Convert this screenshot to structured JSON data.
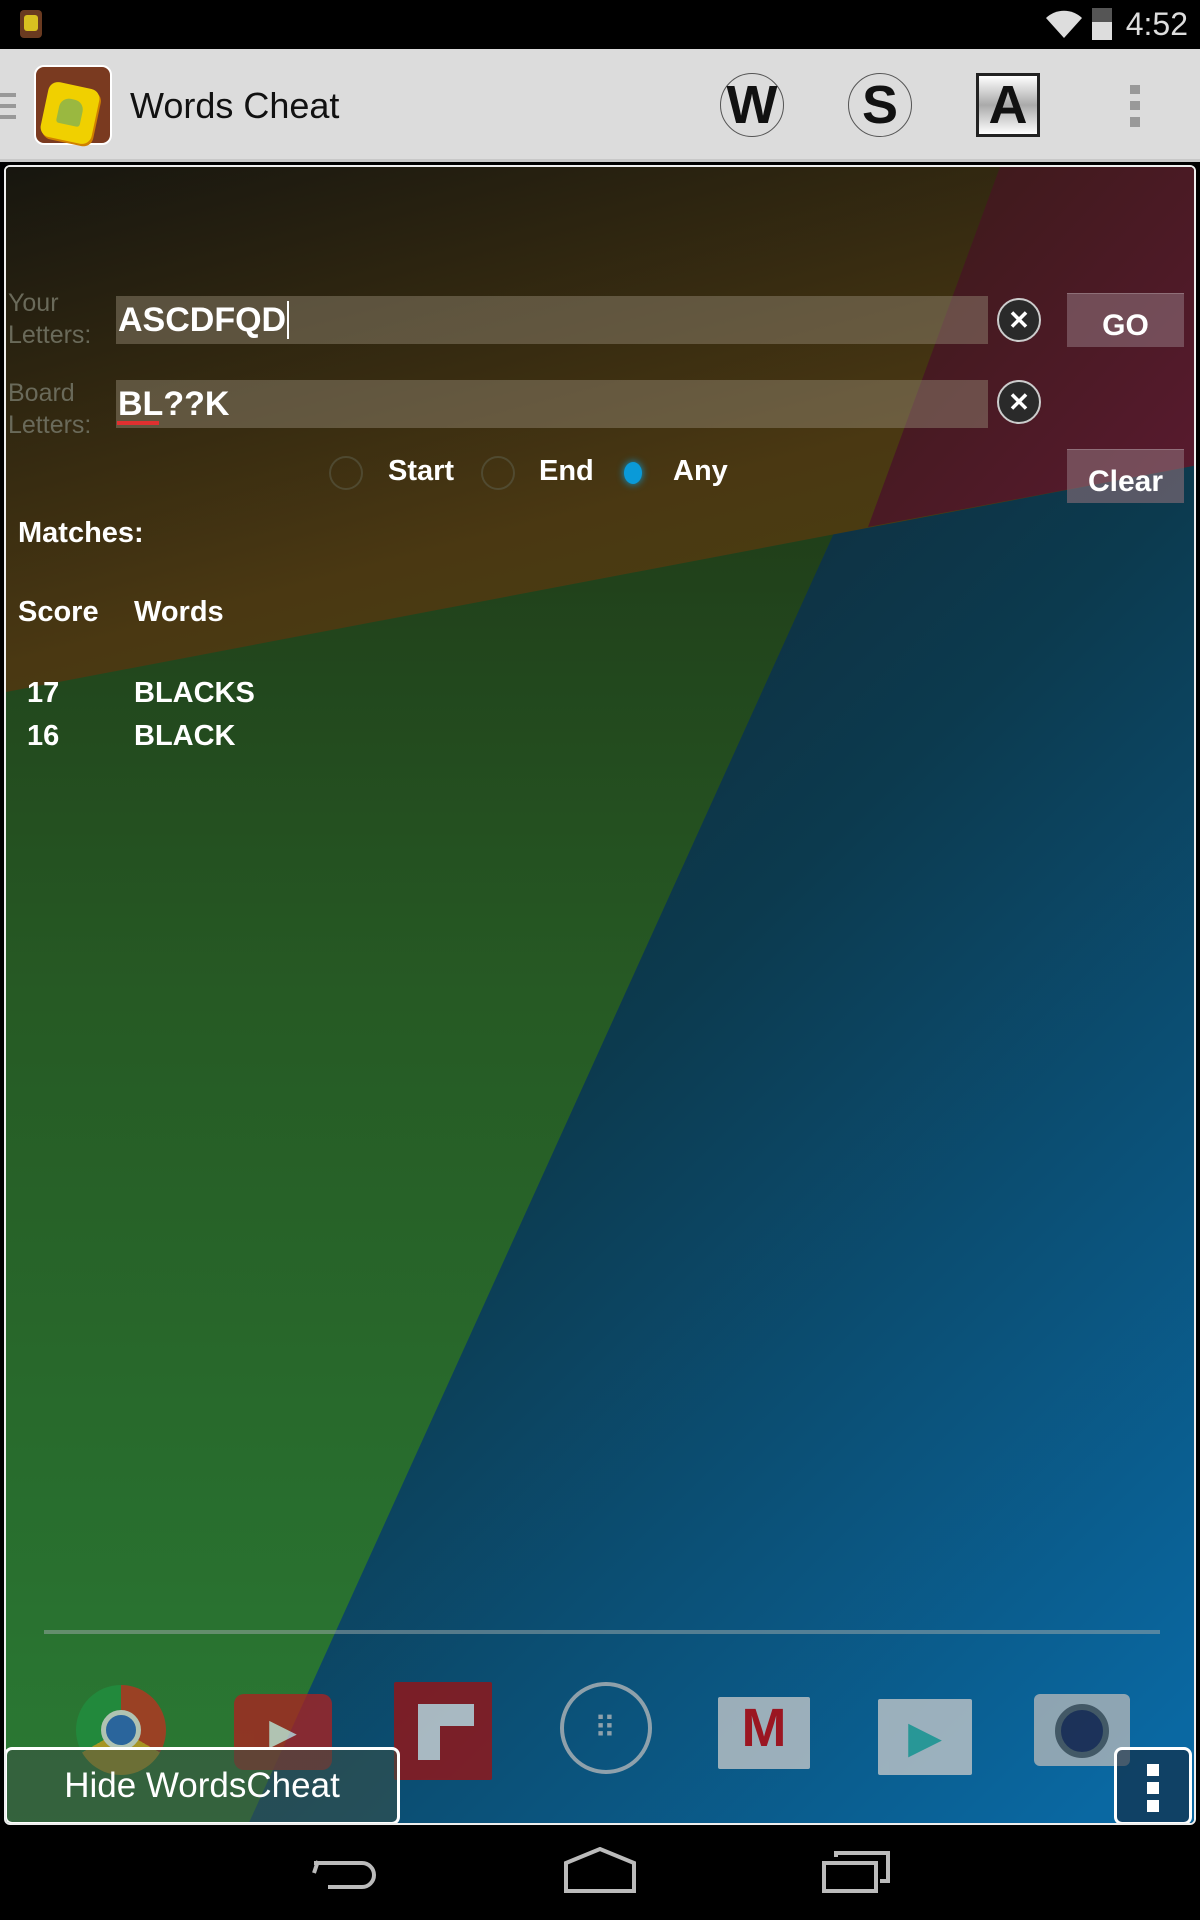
{
  "status_bar": {
    "time": "4:52"
  },
  "action_bar": {
    "title": "Words Cheat",
    "mode_buttons": [
      "W",
      "S",
      "A"
    ]
  },
  "form": {
    "your_letters_label": [
      "Your",
      "Letters:"
    ],
    "your_letters_value": "ASCDFQD",
    "board_letters_label": [
      "Board",
      "Letters:"
    ],
    "board_letters_value": "BL??K",
    "go_label": "GO",
    "clear_label": "Clear",
    "positions": [
      {
        "label": "Start",
        "selected": false
      },
      {
        "label": "End",
        "selected": false
      },
      {
        "label": "Any",
        "selected": true
      }
    ]
  },
  "results": {
    "matches_label": "Matches:",
    "headers": {
      "score": "Score",
      "words": "Words"
    },
    "rows": [
      {
        "score": "17",
        "word": "BLACKS"
      },
      {
        "score": "16",
        "word": "BLACK"
      }
    ]
  },
  "overlay": {
    "hide_label": "Hide WordsCheat"
  },
  "dock_icons": [
    "chrome-icon",
    "youtube-icon",
    "flipboard-icon",
    "app-drawer-icon",
    "gmail-icon",
    "play-store-icon",
    "camera-icon"
  ],
  "colors": {
    "accent": "#0a9ad8"
  }
}
